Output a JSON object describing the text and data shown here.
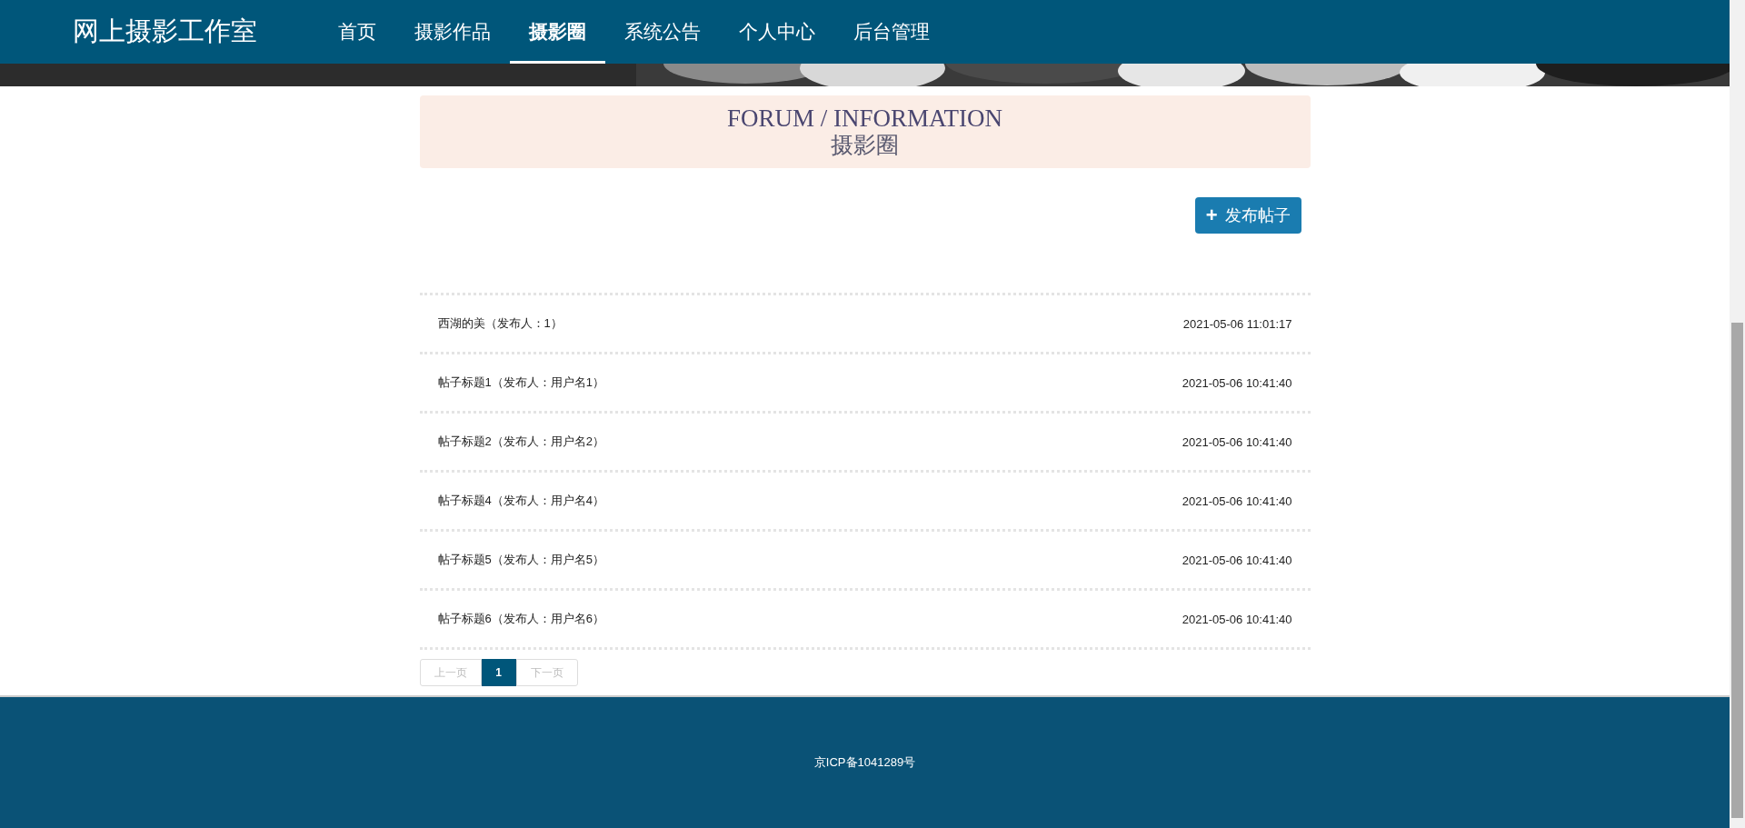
{
  "site": {
    "logo": "网上摄影工作室"
  },
  "nav": [
    {
      "label": "首页",
      "selected": false
    },
    {
      "label": "摄影作品",
      "selected": false
    },
    {
      "label": "摄影圈",
      "selected": true
    },
    {
      "label": "系统公告",
      "selected": false
    },
    {
      "label": "个人中心",
      "selected": false
    },
    {
      "label": "后台管理",
      "selected": false
    }
  ],
  "section": {
    "title": "FORUM / INFORMATION",
    "subtitle": "摄影圈"
  },
  "post_button": {
    "icon": "+",
    "label": "发布帖子"
  },
  "posts": [
    {
      "title": "西湖的美（发布人：1）",
      "time": "2021-05-06 11:01:17"
    },
    {
      "title": "帖子标题1（发布人：用户名1）",
      "time": "2021-05-06 10:41:40"
    },
    {
      "title": "帖子标题2（发布人：用户名2）",
      "time": "2021-05-06 10:41:40"
    },
    {
      "title": "帖子标题4（发布人：用户名4）",
      "time": "2021-05-06 10:41:40"
    },
    {
      "title": "帖子标题5（发布人：用户名5）",
      "time": "2021-05-06 10:41:40"
    },
    {
      "title": "帖子标题6（发布人：用户名6）",
      "time": "2021-05-06 10:41:40"
    }
  ],
  "pagination": [
    {
      "kind": "prev",
      "label": "上一页",
      "disabled": true
    },
    {
      "kind": "page",
      "label": "1",
      "selected": true
    },
    {
      "kind": "next",
      "label": "下一页",
      "disabled": true
    }
  ],
  "footer": {
    "text": "京ICP备1041289号"
  }
}
